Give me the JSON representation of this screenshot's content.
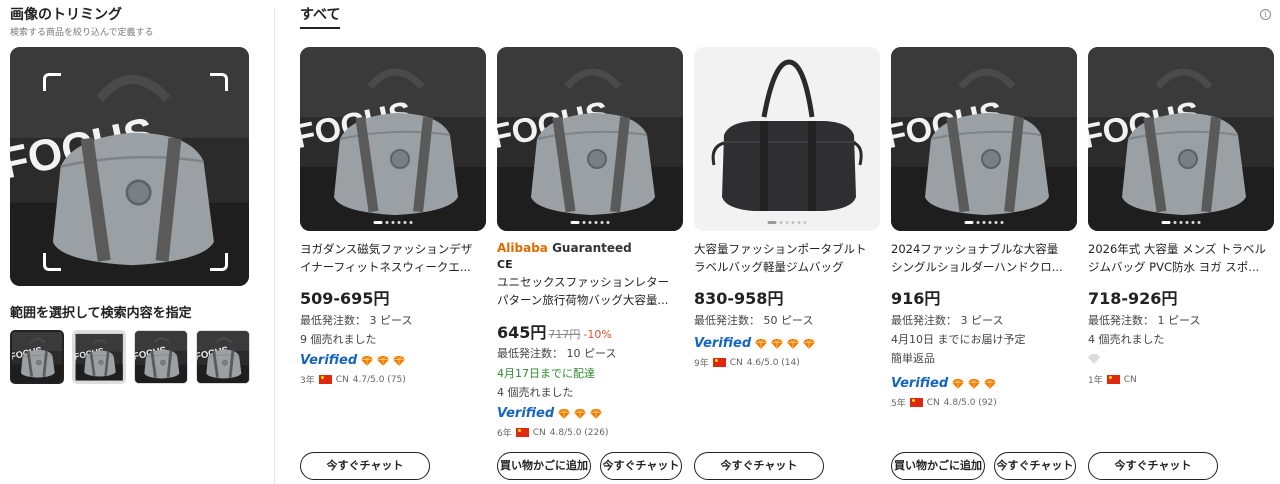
{
  "sidebar": {
    "title": "画像のトリミング",
    "subtitle": "検索する商品を絞り込んで定義する",
    "range_title": "範囲を選択して検索内容を指定"
  },
  "main": {
    "tab": "すべて",
    "info_icon": "i"
  },
  "colors": {
    "verified": "#1565c0",
    "diamond": "#f07c00",
    "discount": "#e2502d",
    "delivery_green": "#2e8b2e",
    "guaranteed_orange": "#e06c00"
  },
  "cards": [
    {
      "title1": "ヨガダンス磁気ファッションデザ",
      "title2": "イナーフィットネスウィークエ...",
      "price": "509-695円",
      "moq": "最低発注数： 3 ピース",
      "sold": "9 個売れました",
      "verified": "Verified",
      "years": "3年",
      "country": "CN",
      "rating": "4.7/5.0 (75)",
      "chat": "今すぐチャット"
    },
    {
      "badge_brand": "Alibaba",
      "badge_text": "Guaranteed",
      "ce": "CE",
      "title1": "ユニセックスファッションレター",
      "title2": "パターン旅行荷物バッグ大容量...",
      "price": "645円",
      "old_price": "717円",
      "discount": "-10%",
      "moq": "最低発注数： 10 ピース",
      "delivery": "4月17日までに配達",
      "sold": "4 個売れました",
      "verified": "Verified",
      "years": "6年",
      "country": "CN",
      "rating": "4.8/5.0 (226)",
      "cart": "買い物かごに追加",
      "chat": "今すぐチャット"
    },
    {
      "title1": "大容量ファッションポータブルト",
      "title2": "ラベルバッグ軽量ジムバッグ",
      "price": "830-958円",
      "moq": "最低発注数： 50 ピース",
      "verified": "Verified",
      "years": "9年",
      "country": "CN",
      "rating": "4.6/5.0 (14)",
      "chat": "今すぐチャット"
    },
    {
      "title1": "2024ファッショナブルな大容量",
      "title2": "シングルショルダーハンドクロ...",
      "price": "916円",
      "moq": "最低発注数： 3 ピース",
      "delivery": "4月10日 までにお届け予定",
      "returns": "簡単返品",
      "verified": "Verified",
      "years": "5年",
      "country": "CN",
      "rating": "4.8/5.0 (92)",
      "cart": "買い物かごに追加",
      "chat": "今すぐチャット"
    },
    {
      "title1": "2026年式 大容量 メンズ トラベル",
      "title2": "ジムバッグ PVC防水 ヨガ スポ...",
      "price": "718-926円",
      "moq": "最低発注数： 1 ピース",
      "sold": "4 個売れました",
      "years": "1年",
      "country": "CN",
      "chat": "今すぐチャット"
    }
  ]
}
